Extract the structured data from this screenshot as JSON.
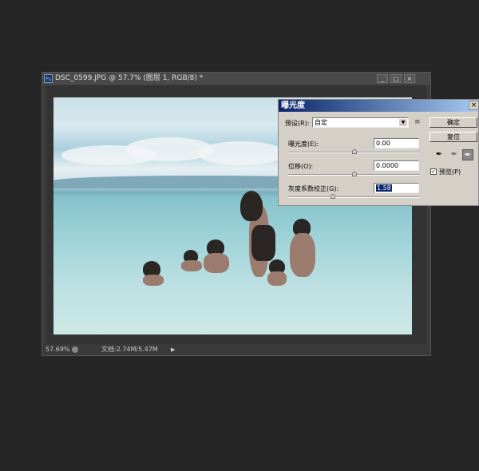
{
  "document_window": {
    "title": "DSC_0599.JPG @ 57.7% (图层 1, RGB/8) *",
    "app_icon": "Ps",
    "buttons": {
      "minimize": "_",
      "maximize": "□",
      "close": "×"
    }
  },
  "status_bar": {
    "zoom": "57.69%",
    "doc_info": "文档:2.74M/5.47M",
    "arrow": "▶"
  },
  "exposure_dialog": {
    "title": "曝光度",
    "close": "×",
    "preset_label": "预设(R):",
    "preset_value": "自定",
    "preset_menu_icon": "≡",
    "exposure": {
      "label": "曝光度(E):",
      "value": "0.00",
      "slider_fraction": 0.5
    },
    "offset": {
      "label": "位移(O):",
      "value": "0.0000",
      "slider_fraction": 0.5
    },
    "gamma": {
      "label": "灰度系数校正(G):",
      "value": "1.58",
      "slider_fraction": 0.33
    },
    "ok_label": "确定",
    "reset_label": "复位",
    "eyedroppers": [
      "black-point-eyedropper",
      "gray-point-eyedropper",
      "white-point-eyedropper"
    ],
    "preview_label": "预览(P)",
    "preview_checked": true
  }
}
